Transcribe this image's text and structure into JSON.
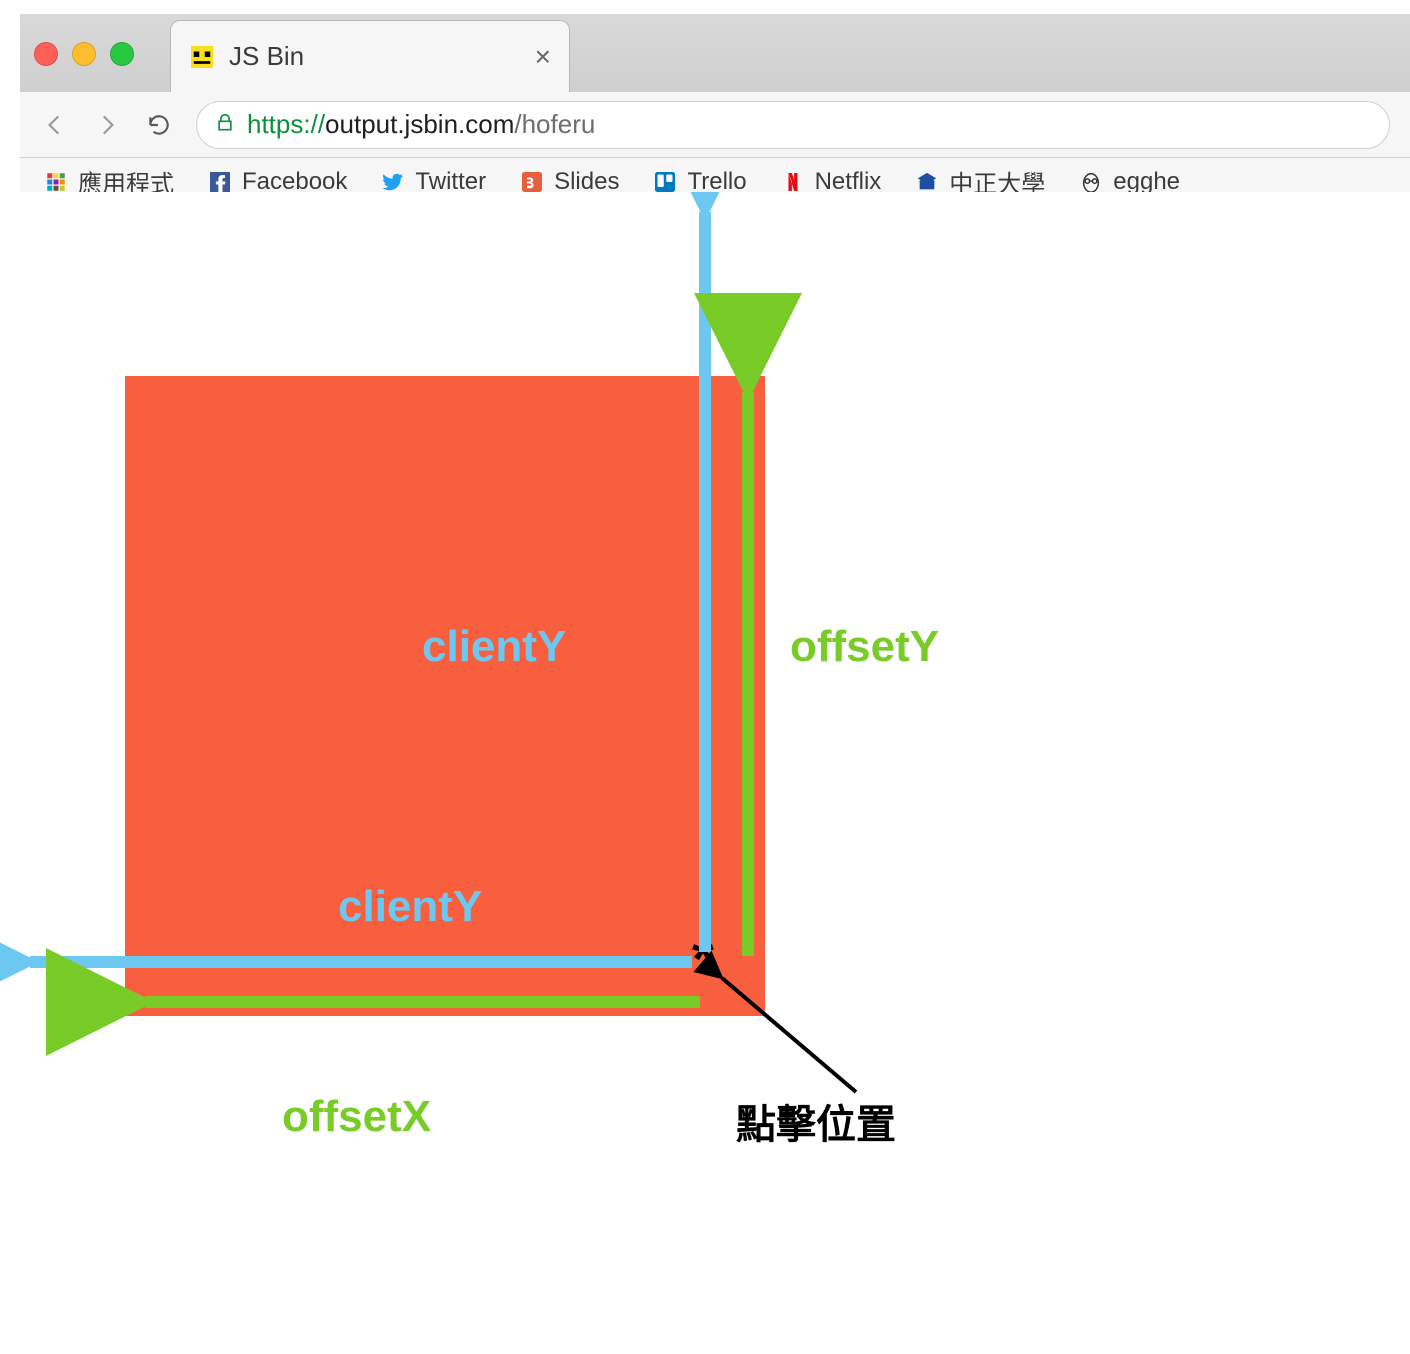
{
  "window": {
    "tab_title": "JS Bin",
    "close_glyph": "×"
  },
  "toolbar": {
    "url_protocol": "https://",
    "url_host": "output.jsbin.com",
    "url_path": "/hoferu"
  },
  "bookmarks": {
    "items": [
      {
        "label": "應用程式",
        "icon": "apps"
      },
      {
        "label": "Facebook",
        "icon": "fb"
      },
      {
        "label": "Twitter",
        "icon": "tw"
      },
      {
        "label": "Slides",
        "icon": "sl"
      },
      {
        "label": "Trello",
        "icon": "tr"
      },
      {
        "label": "Netflix",
        "icon": "nf"
      },
      {
        "label": "中正大學",
        "icon": "edu"
      },
      {
        "label": "egghe",
        "icon": "egg"
      }
    ]
  },
  "diagram": {
    "clientY_vertical_label": "clientY",
    "clientY_horizontal_label": "clientY",
    "offsetY_label": "offsetY",
    "offsetX_label": "offsetX",
    "click_point_label": "點擊位置",
    "click_marker": "*",
    "colors": {
      "box": "#f85f3f",
      "client_arrow": "#6cc7f1",
      "offset_arrow": "#79cc28"
    }
  }
}
